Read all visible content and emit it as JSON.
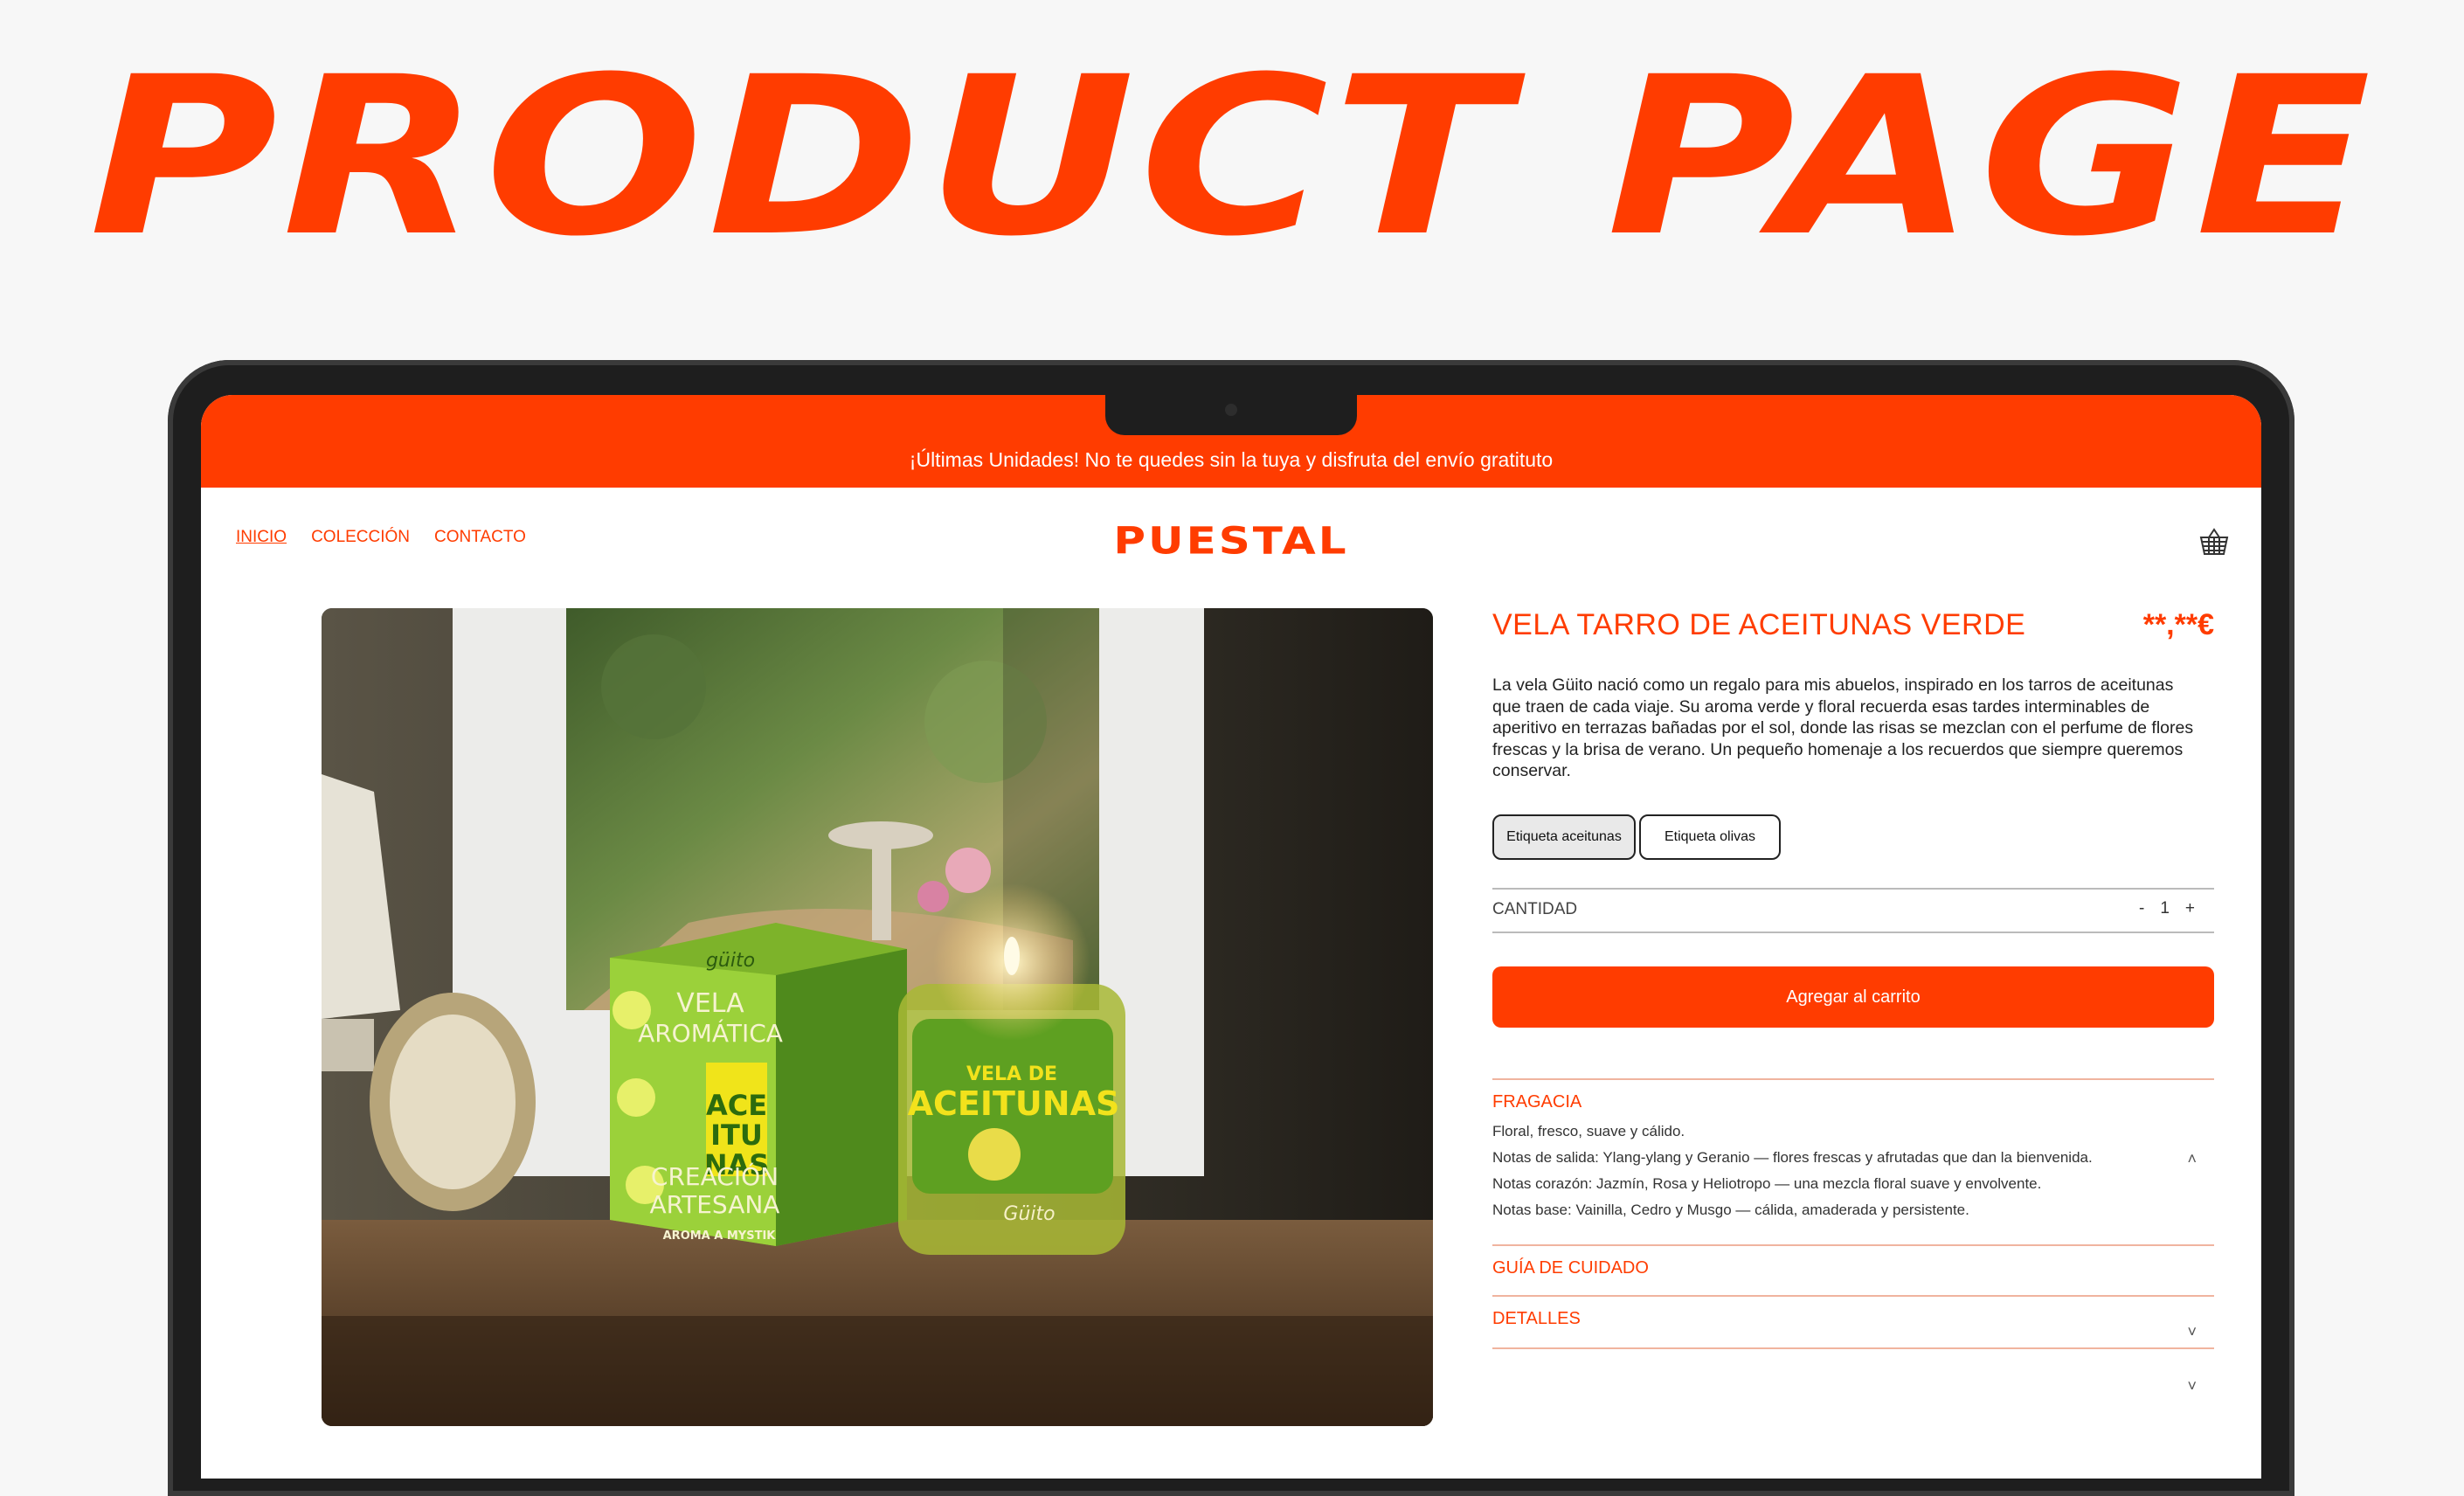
{
  "hero": {
    "title": "PRODUCT PAGE"
  },
  "colors": {
    "accent": "#ff3c00"
  },
  "announcement": "¡Últimas Unidades! No te quedes sin la tuya y disfruta del envío gratituto",
  "nav": {
    "items": [
      "INICIO",
      "COLECCIÓN",
      "CONTACTO"
    ]
  },
  "brand": "PUESTAL",
  "header": {
    "cart_icon": "basket-icon"
  },
  "product": {
    "title": "VELA TARRO DE ACEITUNAS VERDE",
    "price": "**,**€",
    "description": "La vela Güito nació como un regalo para mis abuelos, inspirado en los tarros de aceitunas que traen de cada viaje. Su aroma verde y floral recuerda esas tardes interminables de aperitivo en terrazas bañadas por el sol, donde las risas se mezclan con el perfume de flores frescas y la brisa de verano. Un pequeño homenaje a los recuerdos que siempre queremos conservar.",
    "options": [
      "Etiqueta aceitunas",
      "Etiqueta olivas"
    ],
    "selected_option": "Etiqueta aceitunas",
    "image": {
      "box_brand": "güito",
      "box_line1": "VELA",
      "box_line2": "AROMÁTICA",
      "box_center": "ACE\nITU\nNAS",
      "box_line3": "CREACIÓN",
      "box_line4": "ARTESANA",
      "box_footer": "AROMA A MYSTIK",
      "jar_top": "VELA  DE",
      "jar_main": "ACEITUNAS",
      "jar_brand": "Güito"
    }
  },
  "quantity": {
    "label": "CANTIDAD",
    "minus": "-",
    "value": "1",
    "plus": "+"
  },
  "cart_button": "Agregar al carrito",
  "accordion": {
    "fragrance": {
      "title": "FRAGACIA",
      "lines": [
        "Floral, fresco, suave y cálido.",
        "Notas de salida: Ylang-ylang y Geranio — flores frescas y afrutadas que dan la bienvenida.",
        "Notas corazón: Jazmín, Rosa y Heliotropo — una mezcla floral suave y envolvente.",
        "Notas base: Vainilla, Cedro y Musgo — cálida, amaderada y persistente."
      ]
    },
    "care": {
      "title": "GUÍA DE CUIDADO"
    },
    "details": {
      "title": "DETALLES"
    },
    "chevron_up": "˄",
    "chevron_down": "˅"
  }
}
